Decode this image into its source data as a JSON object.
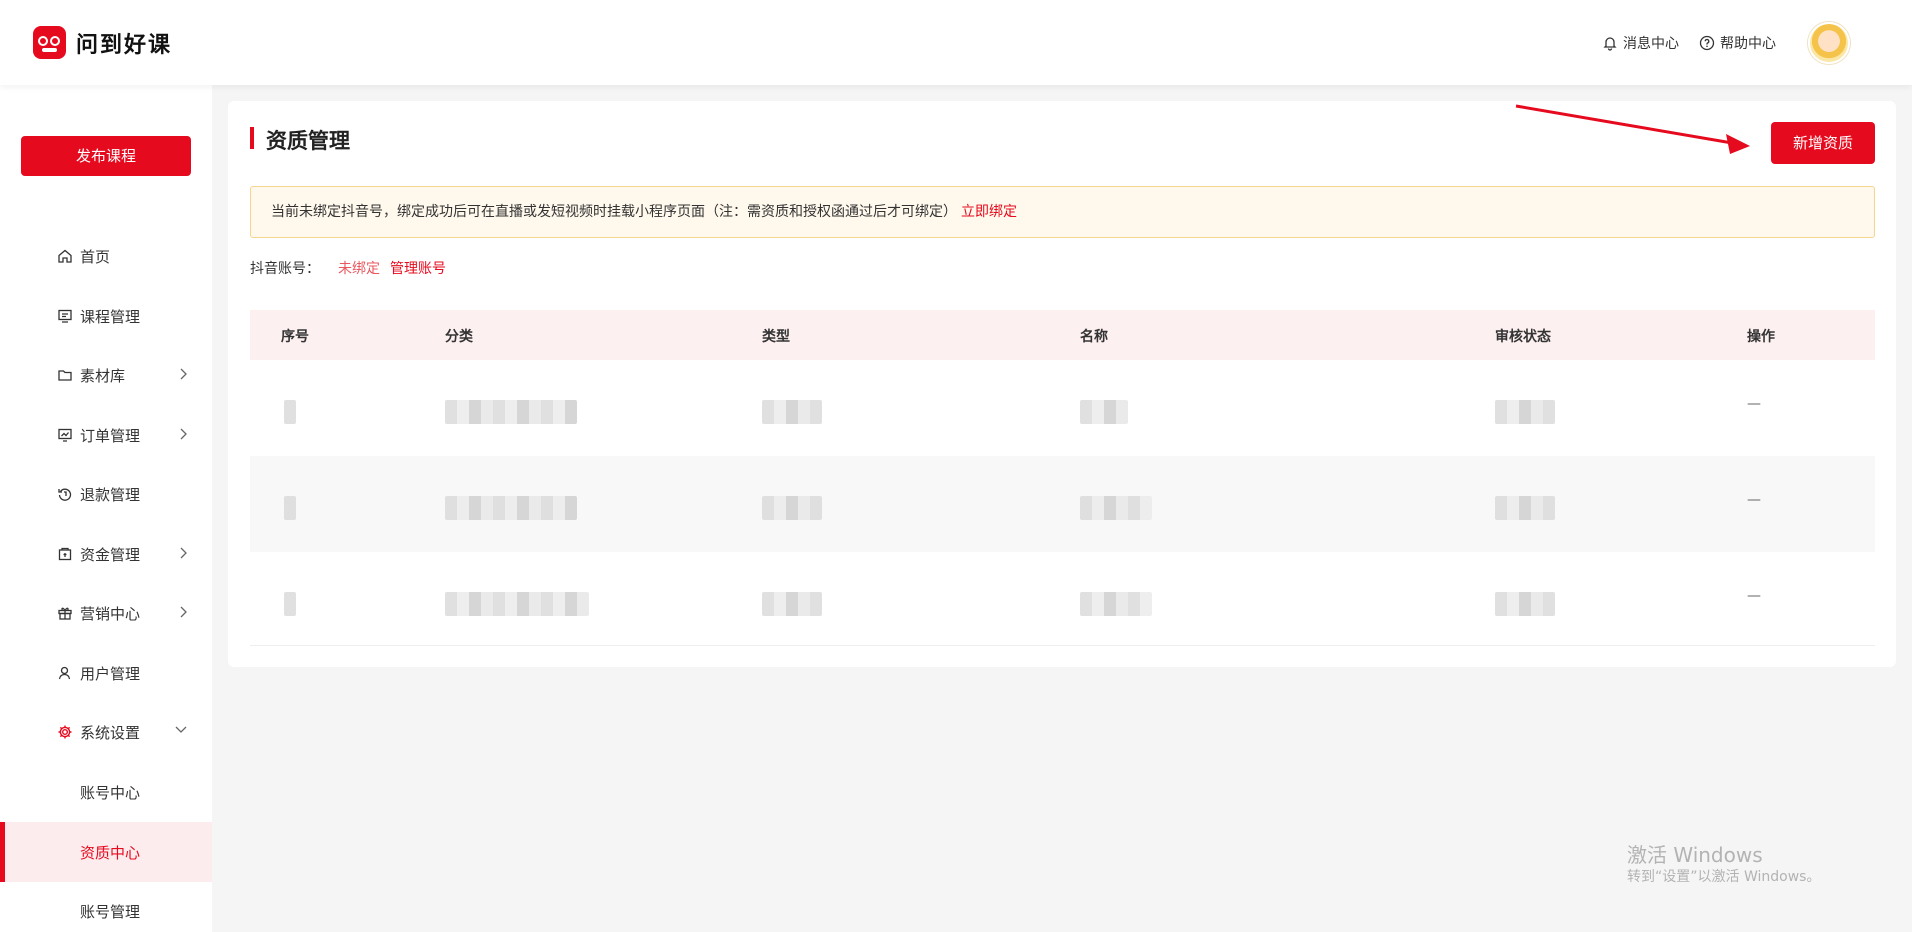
{
  "header": {
    "brand": "问到好课",
    "messages": "消息中心",
    "help": "帮助中心"
  },
  "sidebar": {
    "publish": "发布课程",
    "items": [
      {
        "label": "首页",
        "icon": "home-icon"
      },
      {
        "label": "课程管理",
        "icon": "course-icon"
      },
      {
        "label": "素材库",
        "icon": "folder-icon"
      },
      {
        "label": "订单管理",
        "icon": "order-icon"
      },
      {
        "label": "退款管理",
        "icon": "refund-icon"
      },
      {
        "label": "资金管理",
        "icon": "wallet-icon"
      },
      {
        "label": "营销中心",
        "icon": "gift-icon"
      },
      {
        "label": "用户管理",
        "icon": "user-icon"
      },
      {
        "label": "系统设置",
        "icon": "gear-icon"
      }
    ],
    "sub_items": [
      "账号中心",
      "资质中心",
      "账号管理"
    ]
  },
  "main": {
    "title": "资质管理",
    "add_button": "新增资质",
    "notice": "当前未绑定抖音号，绑定成功后可在直播或发短视频时挂载小程序页面（注：需资质和授权函通过后才可绑定）",
    "notice_link": "立即绑定",
    "account_label": "抖音账号：",
    "account_state": "未绑定",
    "account_manage": "管理账号",
    "table": {
      "columns": [
        "序号",
        "分类",
        "类型",
        "名称",
        "审核状态",
        "操作"
      ],
      "rows": [
        {
          "action": "—"
        },
        {
          "action": "—"
        },
        {
          "action": "—"
        }
      ]
    }
  },
  "watermark": {
    "title": "激活 Windows",
    "subtitle": "转到“设置”以激活 Windows。"
  },
  "colors": {
    "accent": "#e60a1e",
    "notice_bg": "#fff8ec",
    "table_head_bg": "#fdf0f1"
  }
}
